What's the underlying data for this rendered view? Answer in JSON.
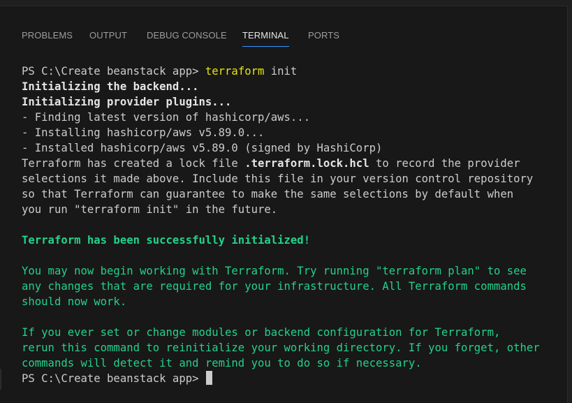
{
  "tabs": [
    {
      "label": "PROBLEMS",
      "active": false
    },
    {
      "label": "OUTPUT",
      "active": false
    },
    {
      "label": "DEBUG CONSOLE",
      "active": false
    },
    {
      "label": "TERMINAL",
      "active": true
    },
    {
      "label": "PORTS",
      "active": false
    }
  ],
  "terminal": {
    "prompt1": "PS C:\\Create beanstack app> ",
    "command": "terraform",
    "command_args": " init",
    "init_backend": "Initializing the backend...",
    "init_plugins": "Initializing provider plugins...",
    "finding": "- Finding latest version of hashicorp/aws...",
    "installing": "- Installing hashicorp/aws v5.89.0...",
    "installed": "- Installed hashicorp/aws v5.89.0 (signed by HashiCorp)",
    "lock_pre": "Terraform has created a lock file ",
    "lock_file": ".terraform.lock.hcl",
    "lock_post": " to record the provider",
    "lock_line2": "selections it made above. Include this file in your version control repository",
    "lock_line3": "so that Terraform can guarantee to make the same selections by default when",
    "lock_line4": "you run \"terraform init\" in the future.",
    "success": "Terraform has been successfully initialized!",
    "begin1": "You may now begin working with Terraform. Try running \"terraform plan\" to see",
    "begin2": "any changes that are required for your infrastructure. All Terraform commands",
    "begin3": "should now work.",
    "modules1": "If you ever set or change modules or backend configuration for Terraform,",
    "modules2": "rerun this command to reinitialize your working directory. If you forget, other",
    "modules3": "commands will detect it and remind you to do so if necessary.",
    "prompt2": "PS C:\\Create beanstack app> "
  },
  "colors": {
    "background": "#181818",
    "text": "#cccccc",
    "command": "#e5e510",
    "success": "#23d18b",
    "tab_active_underline": "#3794ff"
  }
}
